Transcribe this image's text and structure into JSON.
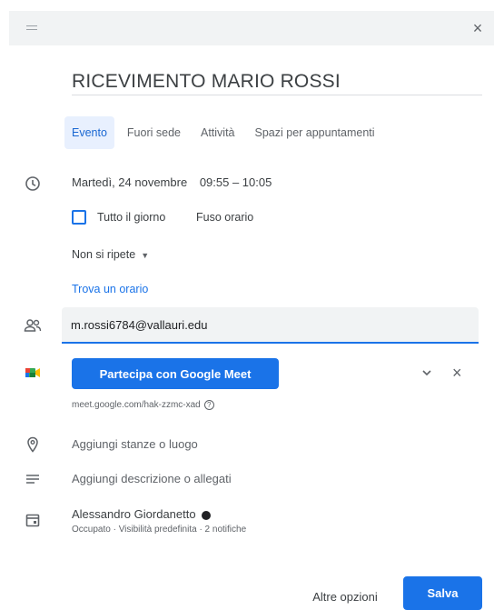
{
  "header": {
    "drag_icon": "drag-handle-icon",
    "close_label": "×"
  },
  "event": {
    "title": "RICEVIMENTO MARIO ROSSI"
  },
  "tabs": [
    {
      "label": "Evento",
      "active": true
    },
    {
      "label": "Fuori sede",
      "active": false
    },
    {
      "label": "Attività",
      "active": false
    },
    {
      "label": "Spazi per appuntamenti",
      "active": false
    }
  ],
  "datetime": {
    "date": "Martedì, 24 novembre",
    "time": "09:55  –  10:05"
  },
  "allday_label": "Tutto il giorno",
  "timezone_label": "Fuso orario",
  "repeat_label": "Non si ripete",
  "find_time_label": "Trova un orario",
  "guests": {
    "value": "m.rossi6784@vallauri.edu"
  },
  "meet": {
    "button_label": "Partecipa con Google Meet",
    "link": "meet.google.com/hak-zzmc-xad",
    "help": "?",
    "remove_label": "×"
  },
  "location_placeholder": "Aggiungi stanze o luogo",
  "description_placeholder": "Aggiungi descrizione o allegati",
  "calendar": {
    "owner": "Alessandro Giordanetto",
    "details": "Occupato · Visibilità predefinita · 2 notifiche"
  },
  "footer": {
    "more_label": "Altre opzioni",
    "save_label": "Salva"
  },
  "colors": {
    "accent": "#1a73e8",
    "tab_active_bg": "#e8f0fe"
  }
}
